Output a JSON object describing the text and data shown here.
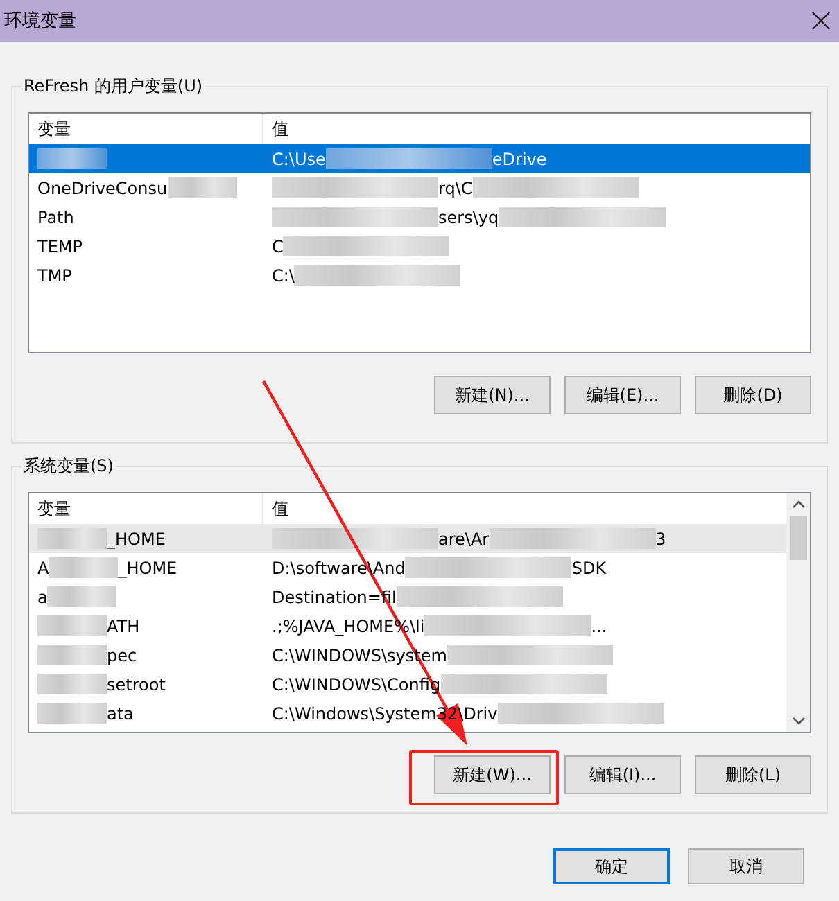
{
  "window": {
    "title": "环境变量"
  },
  "user_group": {
    "label": "ReFresh 的用户变量(U)",
    "columns": [
      "变量",
      "值"
    ],
    "rows": [
      {
        "selected": true,
        "name": [
          {
            "kind": "mask"
          }
        ],
        "value": [
          {
            "kind": "text",
            "text": "C:\\Use"
          },
          {
            "kind": "mask"
          },
          {
            "kind": "text",
            "text": "eDrive"
          }
        ]
      },
      {
        "selected": false,
        "name": [
          {
            "kind": "text",
            "text": "OneDriveConsu"
          },
          {
            "kind": "mask"
          }
        ],
        "value": [
          {
            "kind": "mask"
          },
          {
            "kind": "text",
            "text": "rq\\C"
          },
          {
            "kind": "mask"
          }
        ]
      },
      {
        "selected": false,
        "name": [
          {
            "kind": "text",
            "text": "Path"
          }
        ],
        "value": [
          {
            "kind": "mask"
          },
          {
            "kind": "text",
            "text": "sers\\yq"
          },
          {
            "kind": "mask"
          }
        ]
      },
      {
        "selected": false,
        "name": [
          {
            "kind": "text",
            "text": "TEMP"
          }
        ],
        "value": [
          {
            "kind": "text",
            "text": "C"
          },
          {
            "kind": "mask"
          }
        ]
      },
      {
        "selected": false,
        "name": [
          {
            "kind": "text",
            "text": "TMP"
          }
        ],
        "value": [
          {
            "kind": "text",
            "text": "C:\\"
          },
          {
            "kind": "mask"
          }
        ]
      }
    ],
    "buttons": [
      "新建(N)...",
      "编辑(E)...",
      "删除(D)"
    ]
  },
  "system_group": {
    "label": "系统变量(S)",
    "columns": [
      "变量",
      "值"
    ],
    "rows": [
      {
        "selected": true,
        "name": [
          {
            "kind": "mask"
          },
          {
            "kind": "text",
            "text": "_HOME"
          }
        ],
        "value": [
          {
            "kind": "mask"
          },
          {
            "kind": "text",
            "text": "are\\Ar"
          },
          {
            "kind": "mask"
          },
          {
            "kind": "text",
            "text": "3"
          }
        ]
      },
      {
        "selected": false,
        "name": [
          {
            "kind": "text",
            "text": "A"
          },
          {
            "kind": "mask"
          },
          {
            "kind": "text",
            "text": "_HOME"
          }
        ],
        "value": [
          {
            "kind": "text",
            "text": "D:\\software\\And"
          },
          {
            "kind": "mask"
          },
          {
            "kind": "text",
            "text": "SDK"
          }
        ]
      },
      {
        "selected": false,
        "name": [
          {
            "kind": "text",
            "text": "a"
          },
          {
            "kind": "mask"
          }
        ],
        "value": [
          {
            "kind": "text",
            "text": "Destination=fil"
          },
          {
            "kind": "mask"
          }
        ]
      },
      {
        "selected": false,
        "name": [
          {
            "kind": "mask"
          },
          {
            "kind": "text",
            "text": "ATH"
          }
        ],
        "value": [
          {
            "kind": "text",
            "text": ".;%JAVA_HOME%\\li"
          },
          {
            "kind": "mask"
          },
          {
            "kind": "text",
            "text": "..."
          }
        ]
      },
      {
        "selected": false,
        "name": [
          {
            "kind": "mask"
          },
          {
            "kind": "text",
            "text": "pec"
          }
        ],
        "value": [
          {
            "kind": "text",
            "text": "C:\\WINDOWS\\system"
          },
          {
            "kind": "mask"
          }
        ]
      },
      {
        "selected": false,
        "name": [
          {
            "kind": "mask"
          },
          {
            "kind": "text",
            "text": "setroot"
          }
        ],
        "value": [
          {
            "kind": "text",
            "text": "C:\\WINDOWS\\Config"
          },
          {
            "kind": "mask"
          }
        ]
      },
      {
        "selected": false,
        "name": [
          {
            "kind": "mask"
          },
          {
            "kind": "text",
            "text": "ata"
          }
        ],
        "value": [
          {
            "kind": "text",
            "text": "C:\\Windows\\System32\\Driv"
          },
          {
            "kind": "mask"
          }
        ]
      }
    ],
    "buttons": [
      "新建(W)...",
      "编辑(I)...",
      "删除(L)"
    ]
  },
  "footer_buttons": [
    {
      "label": "确定",
      "kind": "default"
    },
    {
      "label": "取消",
      "kind": "normal"
    }
  ]
}
